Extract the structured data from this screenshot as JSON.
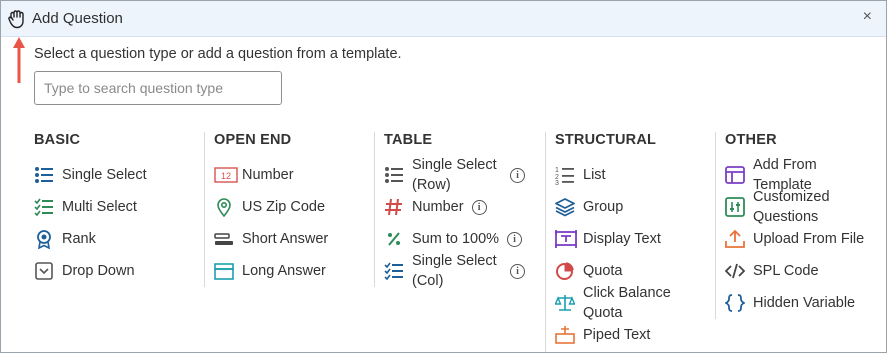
{
  "header": {
    "title": "Add Question",
    "close_glyph": "×"
  },
  "instructions": "Select a question type or add a question from a template.",
  "search": {
    "placeholder": "Type to search question type",
    "value": ""
  },
  "colors": {
    "header_bg": "#eef4fb",
    "blue": "#1f5f99",
    "green": "#2e8b57",
    "orange": "#e8733a",
    "red": "#d14b4b",
    "purple": "#7b3fc4",
    "teal": "#1a9fb0",
    "arrow": "#e8564a"
  },
  "columns": {
    "basic": {
      "heading": "BASIC",
      "items": [
        {
          "label": "Single Select",
          "icon": "list-bullet-icon"
        },
        {
          "label": "Multi Select",
          "icon": "checklist-icon"
        },
        {
          "label": "Rank",
          "icon": "rank-badge-icon"
        },
        {
          "label": "Drop Down",
          "icon": "dropdown-icon"
        }
      ]
    },
    "open_end": {
      "heading": "OPEN END",
      "items": [
        {
          "label": "Number",
          "icon": "number-box-icon",
          "icon_text": "12"
        },
        {
          "label": "US Zip Code",
          "icon": "map-pin-icon"
        },
        {
          "label": "Short Answer",
          "icon": "short-answer-icon"
        },
        {
          "label": "Long Answer",
          "icon": "long-answer-icon"
        }
      ]
    },
    "table": {
      "heading": "TABLE",
      "items": [
        {
          "label": "Single Select (Row)",
          "icon": "list-bullet-icon",
          "info": "i"
        },
        {
          "label": "Number",
          "icon": "hash-icon",
          "info": "i"
        },
        {
          "label": "Sum to 100%",
          "icon": "percent-icon",
          "info": "i"
        },
        {
          "label": "Single Select (Col)",
          "icon": "checklist-icon",
          "info": "i"
        }
      ]
    },
    "structural": {
      "heading": "STRUCTURAL",
      "items": [
        {
          "label": "List",
          "icon": "numbered-list-icon"
        },
        {
          "label": "Group",
          "icon": "layers-icon"
        },
        {
          "label": "Display Text",
          "icon": "display-text-icon"
        },
        {
          "label": "Quota",
          "icon": "pie-chart-icon"
        },
        {
          "label": "Click Balance Quota",
          "icon": "balance-scale-icon"
        },
        {
          "label": "Piped Text",
          "icon": "piped-text-icon"
        }
      ]
    },
    "other": {
      "heading": "OTHER",
      "items": [
        {
          "label": "Add From Template",
          "icon": "template-icon"
        },
        {
          "label": "Customized Questions",
          "icon": "custom-questions-icon"
        },
        {
          "label": "Upload From File",
          "icon": "upload-icon"
        },
        {
          "label": "SPL Code",
          "icon": "code-icon"
        },
        {
          "label": "Hidden Variable",
          "icon": "braces-icon"
        }
      ]
    }
  }
}
